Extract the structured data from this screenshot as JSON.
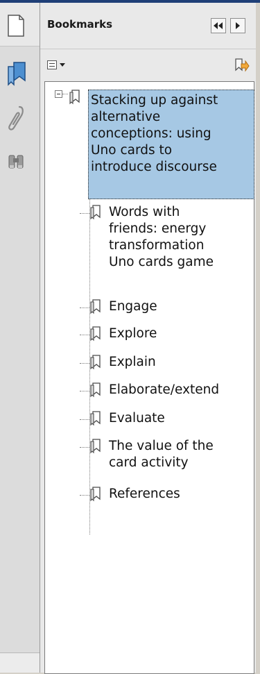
{
  "panel": {
    "title": "Bookmarks"
  },
  "bookmarks": [
    {
      "lines": [
        "Stacking up against",
        "alternative",
        "conceptions: using",
        "Uno cards to",
        "introduce discourse"
      ],
      "selected": true,
      "expanded": true
    },
    {
      "lines": [
        "Words with",
        "friends: energy",
        "transformation",
        "Uno cards game"
      ]
    },
    {
      "lines": [
        "Engage"
      ]
    },
    {
      "lines": [
        "Explore"
      ]
    },
    {
      "lines": [
        "Explain"
      ]
    },
    {
      "lines": [
        "Elaborate/extend"
      ]
    },
    {
      "lines": [
        "Evaluate"
      ]
    },
    {
      "lines": [
        "The value of the",
        "card activity"
      ]
    },
    {
      "lines": [
        "References"
      ]
    }
  ],
  "colors": {
    "selection": "#a6c8e4",
    "top_strip": "#1f3f77"
  },
  "icons": [
    "pages-icon",
    "bookmarks-icon",
    "attachments-icon",
    "search-icon",
    "collapse-icon",
    "expand-icon",
    "options-icon",
    "new-bookmark-icon",
    "bookmark-icon"
  ]
}
